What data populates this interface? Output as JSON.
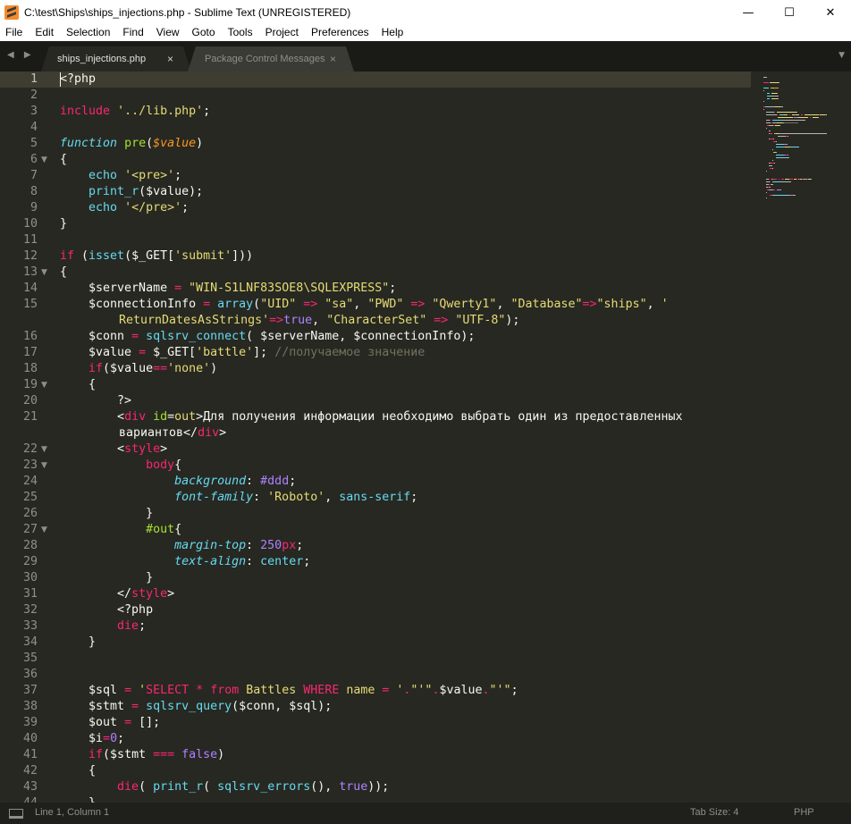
{
  "window": {
    "title": "C:\\test\\Ships\\ships_injections.php - Sublime Text (UNREGISTERED)",
    "buttons": {
      "minimize": "—",
      "maximize": "☐",
      "close": "✕"
    }
  },
  "menu": [
    "File",
    "Edit",
    "Selection",
    "Find",
    "View",
    "Goto",
    "Tools",
    "Project",
    "Preferences",
    "Help"
  ],
  "tabs": [
    {
      "label": "ships_injections.php",
      "active": true,
      "close": "×"
    },
    {
      "label": "Package Control Messages",
      "active": false,
      "close": "×"
    }
  ],
  "tabbar": {
    "nav_arrows": "◀ ▶",
    "dropdown": "▼"
  },
  "editor": {
    "lines": [
      {
        "n": "1",
        "fold": "",
        "current": true,
        "tokens": [
          [
            "",
            "<?php"
          ]
        ]
      },
      {
        "n": "2",
        "fold": "",
        "tokens": []
      },
      {
        "n": "3",
        "fold": "",
        "tokens": [
          [
            "k",
            "include"
          ],
          [
            "",
            " "
          ],
          [
            "s",
            "'../lib.php'"
          ],
          [
            "",
            ";"
          ]
        ]
      },
      {
        "n": "4",
        "fold": "",
        "tokens": []
      },
      {
        "n": "5",
        "fold": "",
        "tokens": [
          [
            "fi",
            "function"
          ],
          [
            "",
            " "
          ],
          [
            "n",
            "pre"
          ],
          [
            "",
            "("
          ],
          [
            "v",
            "$value"
          ],
          [
            "",
            ")"
          ]
        ]
      },
      {
        "n": "6",
        "fold": "▼",
        "tokens": [
          [
            "",
            "{"
          ]
        ]
      },
      {
        "n": "7",
        "fold": "",
        "tokens": [
          [
            "",
            "    "
          ],
          [
            "f",
            "echo"
          ],
          [
            "",
            " "
          ],
          [
            "s",
            "'<pre>'"
          ],
          [
            "",
            ";"
          ]
        ]
      },
      {
        "n": "8",
        "fold": "",
        "tokens": [
          [
            "",
            "    "
          ],
          [
            "f",
            "print_r"
          ],
          [
            "",
            "($value);"
          ]
        ]
      },
      {
        "n": "9",
        "fold": "",
        "tokens": [
          [
            "",
            "    "
          ],
          [
            "f",
            "echo"
          ],
          [
            "",
            " "
          ],
          [
            "s",
            "'</pre>'"
          ],
          [
            "",
            ";"
          ]
        ]
      },
      {
        "n": "10",
        "fold": "",
        "tokens": [
          [
            "",
            "}"
          ]
        ]
      },
      {
        "n": "11",
        "fold": "",
        "tokens": []
      },
      {
        "n": "12",
        "fold": "",
        "tokens": [
          [
            "k",
            "if"
          ],
          [
            "",
            " ("
          ],
          [
            "f",
            "isset"
          ],
          [
            "",
            "($_GET["
          ],
          [
            "s",
            "'submit'"
          ],
          [
            "",
            "]))"
          ]
        ]
      },
      {
        "n": "13",
        "fold": "▼",
        "tokens": [
          [
            "",
            "{"
          ]
        ]
      },
      {
        "n": "14",
        "fold": "",
        "tokens": [
          [
            "",
            "    $serverName "
          ],
          [
            "k",
            "="
          ],
          [
            "",
            " "
          ],
          [
            "s",
            "\"WIN-S1LNF83SOE8\\SQLEXPRESS\""
          ],
          [
            "",
            ";"
          ]
        ]
      },
      {
        "n": "15",
        "fold": "",
        "tokens": [
          [
            "",
            "    $connectionInfo "
          ],
          [
            "k",
            "="
          ],
          [
            "",
            " "
          ],
          [
            "f",
            "array"
          ],
          [
            "",
            "("
          ],
          [
            "s",
            "\"UID\""
          ],
          [
            "",
            " "
          ],
          [
            "k",
            "=>"
          ],
          [
            "",
            " "
          ],
          [
            "s",
            "\"sa\""
          ],
          [
            "",
            ", "
          ],
          [
            "s",
            "\"PWD\""
          ],
          [
            "",
            " "
          ],
          [
            "k",
            "=>"
          ],
          [
            "",
            " "
          ],
          [
            "s",
            "\"Qwerty1\""
          ],
          [
            "",
            ", "
          ],
          [
            "s",
            "\"Database\""
          ],
          [
            "k",
            "=>"
          ],
          [
            "s",
            "\"ships\""
          ],
          [
            "",
            ", "
          ],
          [
            "s",
            "'"
          ]
        ]
      },
      {
        "n": "",
        "fold": "",
        "wrap": true,
        "tokens": [
          [
            "s",
            "ReturnDatesAsStrings'"
          ],
          [
            "k",
            "=>"
          ],
          [
            "p",
            "true"
          ],
          [
            "",
            ", "
          ],
          [
            "s",
            "\"CharacterSet\""
          ],
          [
            "",
            " "
          ],
          [
            "k",
            "=>"
          ],
          [
            "",
            " "
          ],
          [
            "s",
            "\"UTF-8\""
          ],
          [
            "",
            ");"
          ]
        ]
      },
      {
        "n": "16",
        "fold": "",
        "tokens": [
          [
            "",
            "    $conn "
          ],
          [
            "k",
            "="
          ],
          [
            "",
            " "
          ],
          [
            "f",
            "sqlsrv_connect"
          ],
          [
            "",
            "( $serverName, $connectionInfo);"
          ]
        ]
      },
      {
        "n": "17",
        "fold": "",
        "tokens": [
          [
            "",
            "    $value "
          ],
          [
            "k",
            "="
          ],
          [
            "",
            " $_GET["
          ],
          [
            "s",
            "'battle'"
          ],
          [
            "",
            "]; "
          ],
          [
            "c",
            "//получаемое значение"
          ]
        ]
      },
      {
        "n": "18",
        "fold": "",
        "tokens": [
          [
            "",
            "    "
          ],
          [
            "k",
            "if"
          ],
          [
            "",
            "($value"
          ],
          [
            "k",
            "=="
          ],
          [
            "s",
            "'none'"
          ],
          [
            "",
            ")"
          ]
        ]
      },
      {
        "n": "19",
        "fold": "▼",
        "tokens": [
          [
            "",
            "    {"
          ]
        ]
      },
      {
        "n": "20",
        "fold": "",
        "tokens": [
          [
            "",
            "        ?>"
          ]
        ]
      },
      {
        "n": "21",
        "fold": "",
        "tokens": [
          [
            "",
            "        <"
          ],
          [
            "t",
            "div"
          ],
          [
            "",
            " "
          ],
          [
            "a",
            "id"
          ],
          [
            "",
            "="
          ],
          [
            "s",
            "out"
          ],
          [
            "",
            ">Для получения информации необходимо выбрать один из предоставленных"
          ]
        ]
      },
      {
        "n": "",
        "fold": "",
        "wrap": true,
        "tokens": [
          [
            "",
            "вариантов</"
          ],
          [
            "t",
            "div"
          ],
          [
            "",
            ">"
          ]
        ]
      },
      {
        "n": "22",
        "fold": "▼",
        "tokens": [
          [
            "",
            "        <"
          ],
          [
            "t",
            "style"
          ],
          [
            "",
            ">"
          ]
        ]
      },
      {
        "n": "23",
        "fold": "▼",
        "tokens": [
          [
            "",
            "            "
          ],
          [
            "t",
            "body"
          ],
          [
            "",
            "{"
          ]
        ]
      },
      {
        "n": "24",
        "fold": "",
        "tokens": [
          [
            "",
            "                "
          ],
          [
            "fi",
            "background"
          ],
          [
            "",
            ": "
          ],
          [
            "p",
            "#ddd"
          ],
          [
            "",
            ";"
          ]
        ]
      },
      {
        "n": "25",
        "fold": "",
        "tokens": [
          [
            "",
            "                "
          ],
          [
            "fi",
            "font-family"
          ],
          [
            "",
            ": "
          ],
          [
            "s",
            "'Roboto'"
          ],
          [
            "",
            ", "
          ],
          [
            "f",
            "sans-serif"
          ],
          [
            "",
            ";"
          ]
        ]
      },
      {
        "n": "26",
        "fold": "",
        "tokens": [
          [
            "",
            "            }"
          ]
        ]
      },
      {
        "n": "27",
        "fold": "▼",
        "tokens": [
          [
            "",
            "            "
          ],
          [
            "n",
            "#out"
          ],
          [
            "",
            "{"
          ]
        ]
      },
      {
        "n": "28",
        "fold": "",
        "tokens": [
          [
            "",
            "                "
          ],
          [
            "fi",
            "margin-top"
          ],
          [
            "",
            ": "
          ],
          [
            "p",
            "250"
          ],
          [
            "k",
            "px"
          ],
          [
            "",
            ";"
          ]
        ]
      },
      {
        "n": "29",
        "fold": "",
        "tokens": [
          [
            "",
            "                "
          ],
          [
            "fi",
            "text-align"
          ],
          [
            "",
            ": "
          ],
          [
            "f",
            "center"
          ],
          [
            "",
            ";"
          ]
        ]
      },
      {
        "n": "30",
        "fold": "",
        "tokens": [
          [
            "",
            "            }"
          ]
        ]
      },
      {
        "n": "31",
        "fold": "",
        "tokens": [
          [
            "",
            "        </"
          ],
          [
            "t",
            "style"
          ],
          [
            "",
            ">"
          ]
        ]
      },
      {
        "n": "32",
        "fold": "",
        "tokens": [
          [
            "",
            "        <?php"
          ]
        ]
      },
      {
        "n": "33",
        "fold": "",
        "tokens": [
          [
            "",
            "        "
          ],
          [
            "k",
            "die"
          ],
          [
            "",
            ";"
          ]
        ]
      },
      {
        "n": "34",
        "fold": "",
        "tokens": [
          [
            "",
            "    }"
          ]
        ]
      },
      {
        "n": "35",
        "fold": "",
        "tokens": []
      },
      {
        "n": "36",
        "fold": "",
        "tokens": []
      },
      {
        "n": "37",
        "fold": "",
        "tokens": [
          [
            "",
            "    $sql "
          ],
          [
            "k",
            "="
          ],
          [
            "",
            " "
          ],
          [
            "s",
            "'"
          ],
          [
            "k",
            "SELECT"
          ],
          [
            "s",
            " "
          ],
          [
            "k",
            "*"
          ],
          [
            "s",
            " "
          ],
          [
            "k",
            "from"
          ],
          [
            "s",
            " Battles "
          ],
          [
            "k",
            "WHERE"
          ],
          [
            "s",
            " name "
          ],
          [
            "k",
            "="
          ],
          [
            "s",
            " '"
          ],
          [
            "k",
            "."
          ],
          [
            "s",
            "\"'\""
          ],
          [
            "k",
            "."
          ],
          [
            "",
            "$value"
          ],
          [
            "k",
            "."
          ],
          [
            "s",
            "\"'\""
          ],
          [
            "",
            ";"
          ]
        ]
      },
      {
        "n": "38",
        "fold": "",
        "tokens": [
          [
            "",
            "    $stmt "
          ],
          [
            "k",
            "="
          ],
          [
            "",
            " "
          ],
          [
            "f",
            "sqlsrv_query"
          ],
          [
            "",
            "($conn, $sql);"
          ]
        ]
      },
      {
        "n": "39",
        "fold": "",
        "tokens": [
          [
            "",
            "    $out "
          ],
          [
            "k",
            "="
          ],
          [
            "",
            " [];"
          ]
        ]
      },
      {
        "n": "40",
        "fold": "",
        "tokens": [
          [
            "",
            "    $i"
          ],
          [
            "k",
            "="
          ],
          [
            "p",
            "0"
          ],
          [
            "",
            ";"
          ]
        ]
      },
      {
        "n": "41",
        "fold": "",
        "tokens": [
          [
            "",
            "    "
          ],
          [
            "k",
            "if"
          ],
          [
            "",
            "($stmt "
          ],
          [
            "k",
            "==="
          ],
          [
            "",
            " "
          ],
          [
            "p",
            "false"
          ],
          [
            "",
            ")"
          ]
        ]
      },
      {
        "n": "42",
        "fold": "",
        "tokens": [
          [
            "",
            "    {"
          ]
        ]
      },
      {
        "n": "43",
        "fold": "",
        "tokens": [
          [
            "",
            "        "
          ],
          [
            "k",
            "die"
          ],
          [
            "",
            "( "
          ],
          [
            "f",
            "print_r"
          ],
          [
            "",
            "( "
          ],
          [
            "f",
            "sqlsrv_errors"
          ],
          [
            "",
            "(), "
          ],
          [
            "p",
            "true"
          ],
          [
            "",
            "));"
          ]
        ]
      },
      {
        "n": "44",
        "fold": "",
        "tokens": [
          [
            "",
            "    }"
          ]
        ]
      }
    ]
  },
  "status": {
    "position": "Line 1, Column 1",
    "tab_size": "Tab Size: 4",
    "syntax": "PHP"
  },
  "colors": {
    "background": "#272822",
    "keyword": "#f92672",
    "string": "#e6db74",
    "function": "#66d9ef",
    "name": "#a6e22e",
    "variable": "#fd971f",
    "comment": "#75715e",
    "number": "#ae81ff"
  }
}
